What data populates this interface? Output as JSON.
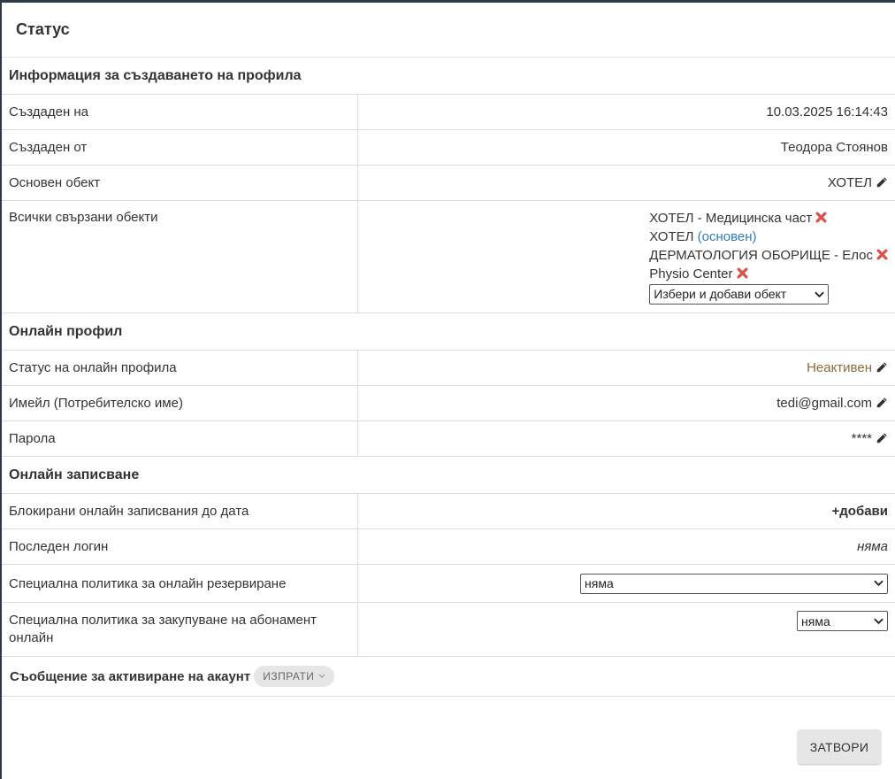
{
  "modal": {
    "title": "Статус",
    "close_label": "ЗАТВОРИ"
  },
  "profile_info": {
    "section_title": "Информация за създаването на профила",
    "created_on_label": "Създаден на",
    "created_on_value": "10.03.2025 16:14:43",
    "created_by_label": "Създаден от",
    "created_by_value": "Теодора Стоянов",
    "main_object_label": "Основен обект",
    "main_object_value": "ХОТЕЛ",
    "linked_objects_label": "Всички свързани обекти",
    "linked_objects": [
      {
        "name": "ХОТЕЛ - Медицинска част",
        "removable": true
      },
      {
        "name": "ХОТЕЛ",
        "note": "(основен)",
        "removable": false
      },
      {
        "name": "ДЕРМАТОЛОГИЯ ОБОРИЩЕ - Елос",
        "removable": true
      },
      {
        "name": "Physio Center",
        "removable": true
      }
    ],
    "add_object_select": "Избери и добави обект"
  },
  "online_profile": {
    "section_title": "Онлайн профил",
    "status_label": "Статус на онлайн профила",
    "status_value": "Неактивен",
    "email_label": "Имейл (Потребителско име)",
    "email_value": "tedi@gmail.com",
    "password_label": "Парола",
    "password_value": "****"
  },
  "online_booking": {
    "section_title": "Онлайн записване",
    "blocked_label": "Блокирани онлайн записвания до дата",
    "blocked_add": "+добави",
    "last_login_label": "Последен логин",
    "last_login_value": "няма",
    "reservation_policy_label": "Специална политика за онлайн резервиране",
    "reservation_policy_value": "няма",
    "subscription_policy_label": "Специална политика за закупуване на абонамент онлайн",
    "subscription_policy_value": "няма"
  },
  "activation": {
    "label": "Съобщение за активиране на акаунт",
    "send_label": "ИЗПРАТИ"
  },
  "colors": {
    "inactive_status": "#8a6d3b",
    "link_blue": "#337ab7",
    "remove_red": "#d9534f"
  }
}
